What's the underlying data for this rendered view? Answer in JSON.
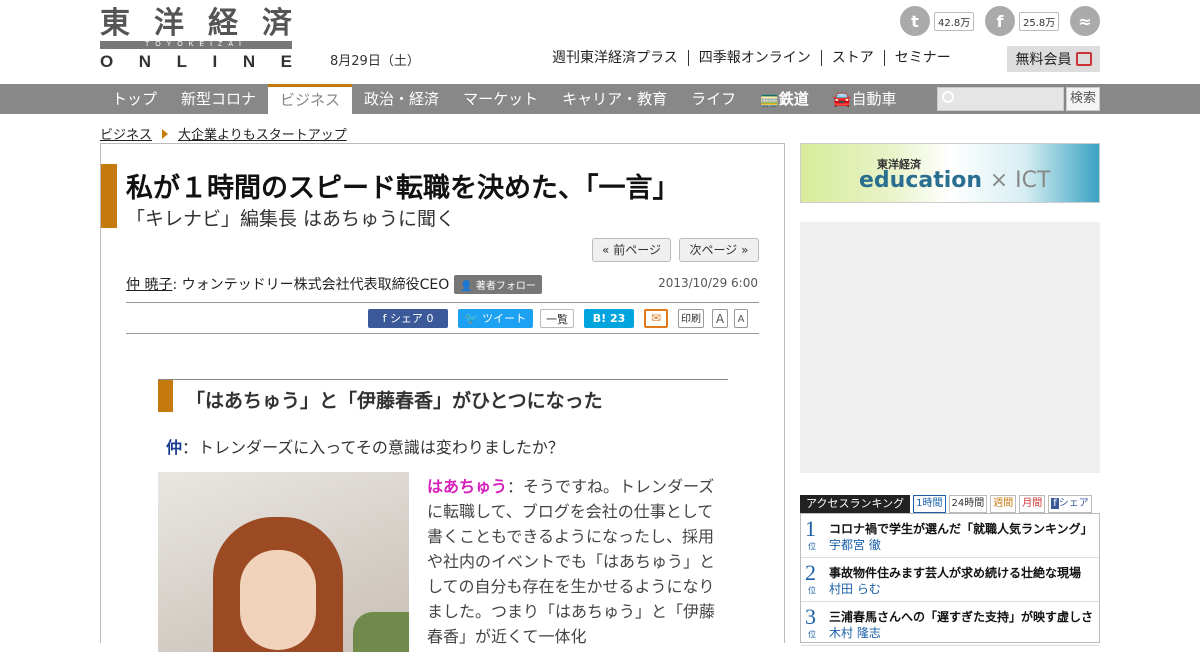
{
  "header": {
    "logo": {
      "kanji": [
        "東",
        "洋",
        "経",
        "済"
      ],
      "romaji": "TOYOKEIZAI",
      "online": [
        "O",
        "N",
        "L",
        "I",
        "N",
        "E"
      ]
    },
    "date": "8月29日（土）",
    "sns": [
      {
        "name": "twitter-icon",
        "glyph": "t",
        "count": "42.8万"
      },
      {
        "name": "facebook-icon",
        "glyph": "f",
        "count": "25.8万"
      },
      {
        "name": "rss-icon",
        "glyph": "≈",
        "count": ""
      }
    ],
    "links": [
      "週刊東洋経済プラス",
      "四季報オンライン",
      "ストア",
      "セミナー"
    ],
    "member": "無料会員"
  },
  "nav": {
    "items": [
      "トップ",
      "新型コロナ",
      "ビジネス",
      "政治・経済",
      "マーケット",
      "キャリア・教育",
      "ライフ",
      "鉄道",
      "自動車"
    ],
    "active_index": 2,
    "search_button": "検索"
  },
  "breadcrumb": [
    "ビジネス",
    "大企業よりもスタートアップ"
  ],
  "article": {
    "title": "私が１時間のスピード転職を決めた、「一言」",
    "subtitle": "「キレナビ」編集長 はあちゅうに聞く",
    "prev": "« 前ページ",
    "next": "次ページ »",
    "author": "仲 暁子",
    "author_title": ": ウォンテッドリー株式会社代表取締役CEO",
    "follow": "著者フォロー",
    "date": "2013/10/29 6:00",
    "share": {
      "fb": "シェア",
      "fb_count": "0",
      "tweet": "ツイート",
      "list": "一覧",
      "hatena": "B! 23",
      "print": "印刷",
      "a_large": "A",
      "a_small": "A"
    },
    "section_heading": "「はあちゅう」と「伊藤春香」がひとつになった",
    "q_speaker": "仲",
    "q_text": "：トレンダーズに入ってその意識は変わりましたか？",
    "a_speaker": "はあちゅう",
    "a_text": "：そうですね。トレンダーズに転職して、ブログを会社の仕事として書くこともできるようになったし、採用や社内のイベントでも「はあちゅう」としての自分も存在を生かせるようになりました。つまり「はあちゅう」と「伊藤春香」が近くて一体化"
  },
  "ad": {
    "brand": "東洋経済",
    "product": "education",
    "suffix": "× ICT"
  },
  "ranking": {
    "label": "アクセスランキング",
    "tabs": [
      "1時間",
      "24時間",
      "週間",
      "月間",
      "シェア"
    ],
    "rank_suffix": "位",
    "rows": [
      {
        "rank": "1",
        "title": "コロナ禍で学生が選んだ「就職人気ランキング」",
        "author": "宇都宮 徹"
      },
      {
        "rank": "2",
        "title": "事故物件住みます芸人が求め続ける壮絶な現場",
        "author": "村田 らむ"
      },
      {
        "rank": "3",
        "title": "三浦春馬さんへの「遅すぎた支持」が映す虚しさ",
        "author": "木村 隆志"
      }
    ]
  },
  "colors": {
    "accent": "#c57a0d",
    "nav": "#888888",
    "link_blue": "#1a5fa8",
    "speaker_pink": "#d61fbb"
  }
}
